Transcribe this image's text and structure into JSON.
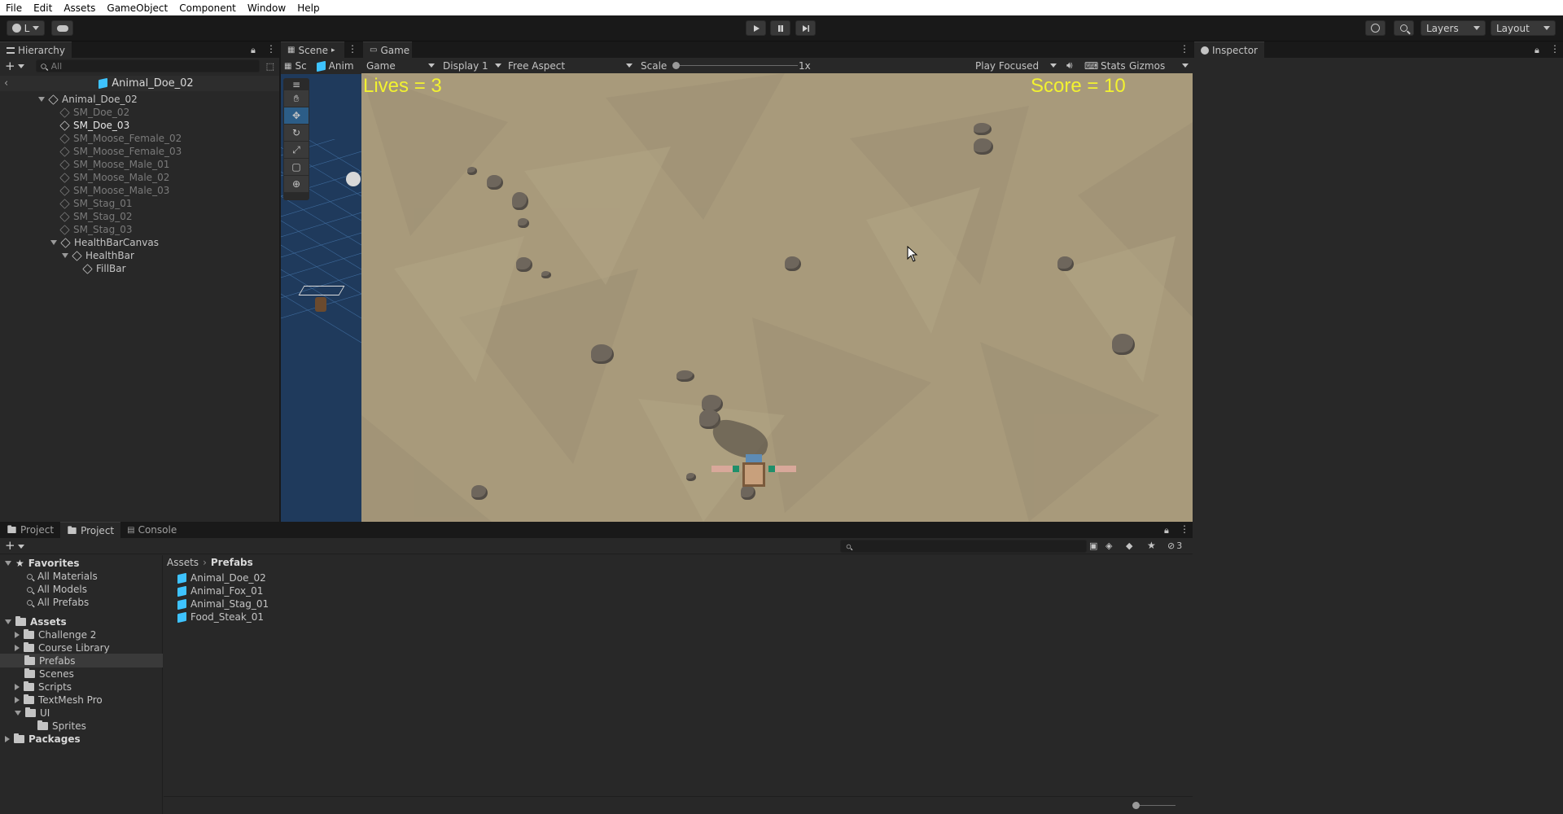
{
  "menu": [
    "File",
    "Edit",
    "Assets",
    "GameObject",
    "Component",
    "Window",
    "Help"
  ],
  "toolbar": {
    "account_label": "L",
    "layers_label": "Layers",
    "layout_label": "Layout"
  },
  "hierarchy": {
    "tab_label": "Hierarchy",
    "search_placeholder": "All",
    "breadcrumb": "Animal_Doe_02",
    "items": [
      {
        "label": "Animal_Doe_02",
        "state": "normal"
      },
      {
        "label": "SM_Doe_02",
        "state": "disabled"
      },
      {
        "label": "SM_Doe_03",
        "state": "normal"
      },
      {
        "label": "SM_Moose_Female_02",
        "state": "disabled"
      },
      {
        "label": "SM_Moose_Female_03",
        "state": "disabled"
      },
      {
        "label": "SM_Moose_Male_01",
        "state": "disabled"
      },
      {
        "label": "SM_Moose_Male_02",
        "state": "disabled"
      },
      {
        "label": "SM_Moose_Male_03",
        "state": "disabled"
      },
      {
        "label": "SM_Stag_01",
        "state": "disabled"
      },
      {
        "label": "SM_Stag_02",
        "state": "disabled"
      },
      {
        "label": "SM_Stag_03",
        "state": "disabled"
      },
      {
        "label": "HealthBarCanvas",
        "state": "normal"
      },
      {
        "label": "HealthBar",
        "state": "normal"
      },
      {
        "label": "FillBar",
        "state": "normal"
      }
    ]
  },
  "scene": {
    "tab_label": "Scene",
    "title_short": "Sc",
    "prefab_short": "Anim"
  },
  "game": {
    "tab_label": "Game",
    "mode_select": "Game",
    "display_select": "Display 1",
    "aspect_select": "Free Aspect",
    "scale_label": "Scale",
    "scale_value": "1x",
    "play_mode_select": "Play Focused",
    "stats_label": "Stats",
    "gizmos_label": "Gizmos",
    "lives_text": "Lives = 3",
    "score_text": "Score = 10"
  },
  "inspector": {
    "tab_label": "Inspector"
  },
  "bottom": {
    "tabs": [
      "Project",
      "Project",
      "Console"
    ],
    "search_placeholder": "",
    "hidden_count": "3",
    "breadcrumb_root": "Assets",
    "breadcrumb_current": "Prefabs",
    "favorites_label": "Favorites",
    "favorites": [
      "All Materials",
      "All Models",
      "All Prefabs"
    ],
    "assets_label": "Assets",
    "folders": [
      "Challenge 2",
      "Course Library",
      "Prefabs",
      "Scenes",
      "Scripts",
      "TextMesh Pro",
      "UI"
    ],
    "ui_subfolder": "Sprites",
    "packages_label": "Packages",
    "prefabs": [
      "Animal_Doe_02",
      "Animal_Fox_01",
      "Animal_Stag_01",
      "Food_Steak_01"
    ]
  },
  "colors": {
    "hud_text": "#f2f230",
    "selection": "#2c5d87",
    "asset_blue": "#3ec3ff"
  }
}
